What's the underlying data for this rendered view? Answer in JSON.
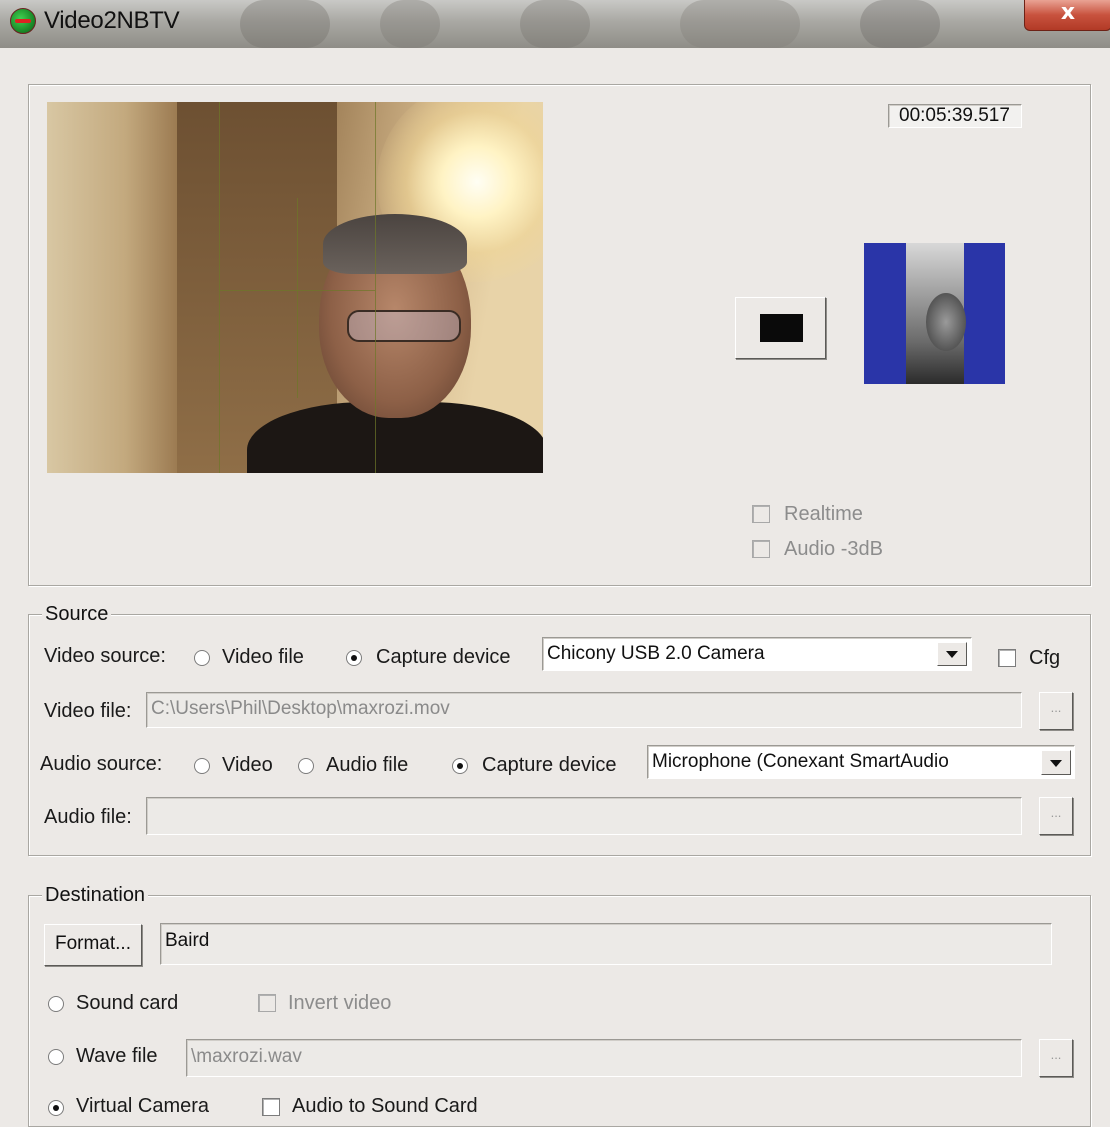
{
  "window": {
    "title": "Video2NBTV",
    "close_glyph": "x"
  },
  "preview": {
    "timecode": "00:05:39.517",
    "realtime_label": "Realtime",
    "audio_3db_label": "Audio -3dB"
  },
  "source": {
    "legend": "Source",
    "video_source_label": "Video source:",
    "video_file_option": "Video file",
    "capture_device_option": "Capture device",
    "video_device": "Chicony USB 2.0 Camera",
    "cfg_label": "Cfg",
    "video_file_label": "Video file:",
    "video_file_path": "C:\\Users\\Phil\\Desktop\\maxrozi.mov",
    "browse_label": "...",
    "audio_source_label": "Audio source:",
    "audio_video_option": "Video",
    "audio_file_option": "Audio file",
    "audio_capture_option": "Capture device",
    "audio_device": "Microphone (Conexant SmartAudio",
    "audio_file_label": "Audio file:",
    "audio_file_path": ""
  },
  "destination": {
    "legend": "Destination",
    "format_button": "Format...",
    "format_value": "Baird",
    "sound_card_option": "Sound card",
    "invert_video_label": "Invert video",
    "wave_file_option": "Wave file",
    "wave_file_path": "\\maxrozi.wav",
    "browse_label": "...",
    "virtual_camera_option": "Virtual Camera",
    "audio_to_sound_card_label": "Audio to Sound Card"
  },
  "colors": {
    "window_bg": "#ece9e6",
    "nbtv_blue": "#2a35a8",
    "close_button": "#c8523e"
  },
  "state": {
    "video_source_selected": "Capture device",
    "audio_source_selected": "Capture device",
    "destination_selected": "Virtual Camera"
  }
}
